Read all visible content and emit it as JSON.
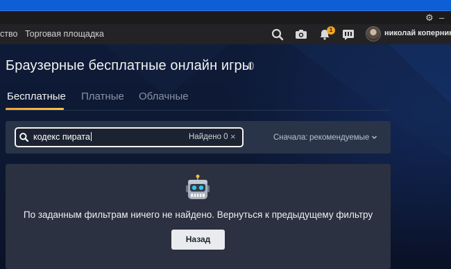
{
  "titlebar": {
    "settings_icon": "gear-icon",
    "minimize_icon": "minimize-icon"
  },
  "nav": {
    "items": [
      {
        "label": "ство"
      },
      {
        "label": "Торговая площадка"
      }
    ],
    "icons": [
      "search-icon",
      "camera-icon",
      "bell-icon",
      "chat-icon"
    ],
    "notification_count": "1",
    "username": "николай коперник"
  },
  "page": {
    "title": "Браузерные бесплатные онлайн игры",
    "count": "0"
  },
  "tabs": [
    {
      "label": "Бесплатные",
      "active": true
    },
    {
      "label": "Платные",
      "active": false
    },
    {
      "label": "Облачные",
      "active": false
    }
  ],
  "search": {
    "value": "кодекс пирата",
    "found_label": "Найдено 0",
    "clear_symbol": "×"
  },
  "sort": {
    "label": "Сначала:",
    "value": "рекомендуемые"
  },
  "empty_state": {
    "message": "По заданным фильтрам ничего не найдено. Вернуться к предыдущему фильтру",
    "button_label": "Назад"
  },
  "colors": {
    "accent": "#f0a53a",
    "badge": "#f2a51d",
    "os_bar": "#0e5fd6",
    "background": "#0e1a35"
  }
}
